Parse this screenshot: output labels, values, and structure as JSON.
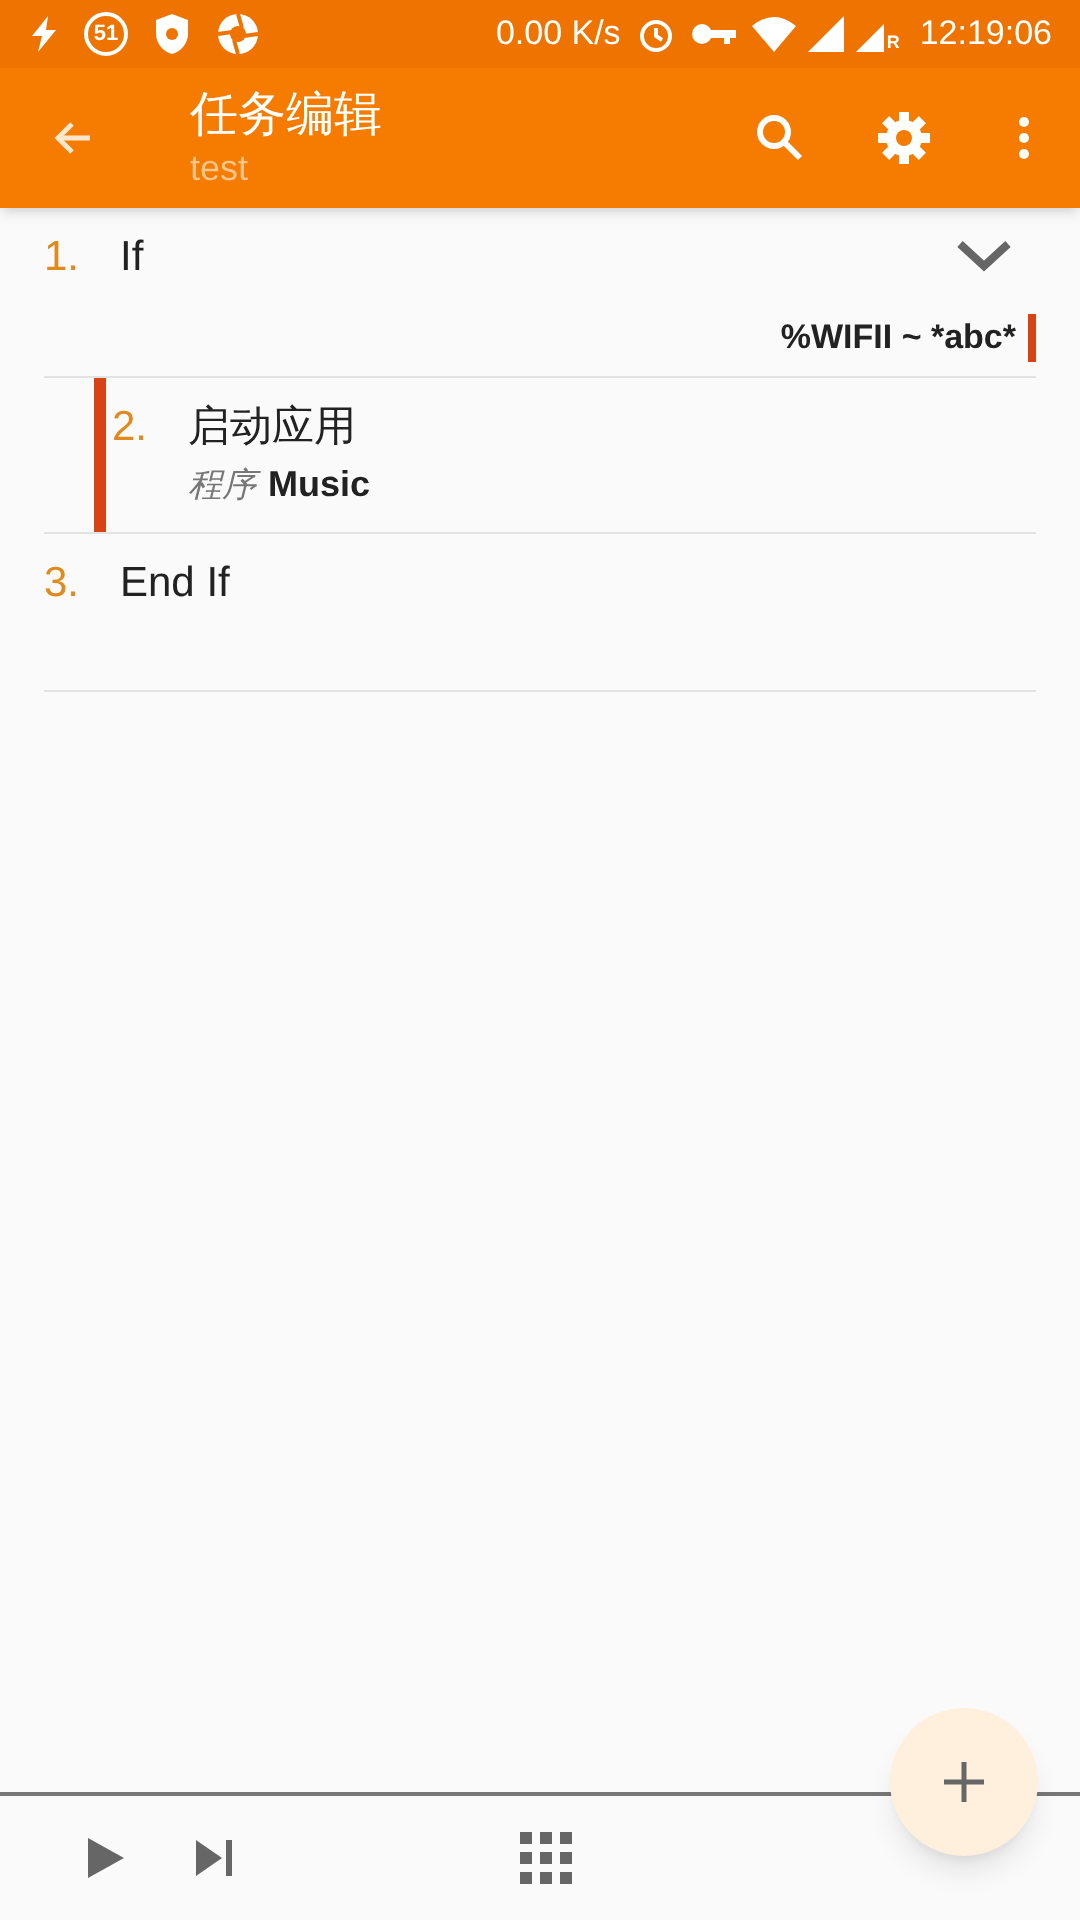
{
  "status_bar": {
    "badge": "51",
    "speed": "0.00 K/s",
    "roaming": "R",
    "time": "12:19:06"
  },
  "app_bar": {
    "title": "任务编辑",
    "subtitle": "test"
  },
  "actions": [
    {
      "kind": "if",
      "number": "1.",
      "name": "If",
      "expanded": false,
      "condition": "%WIFII ~ *abc*",
      "children": [
        {
          "kind": "action",
          "number": "2.",
          "name": "启动应用",
          "param_label": "程序",
          "param_value": "Music"
        }
      ]
    },
    {
      "kind": "endif",
      "number": "3.",
      "name": "End If"
    }
  ]
}
